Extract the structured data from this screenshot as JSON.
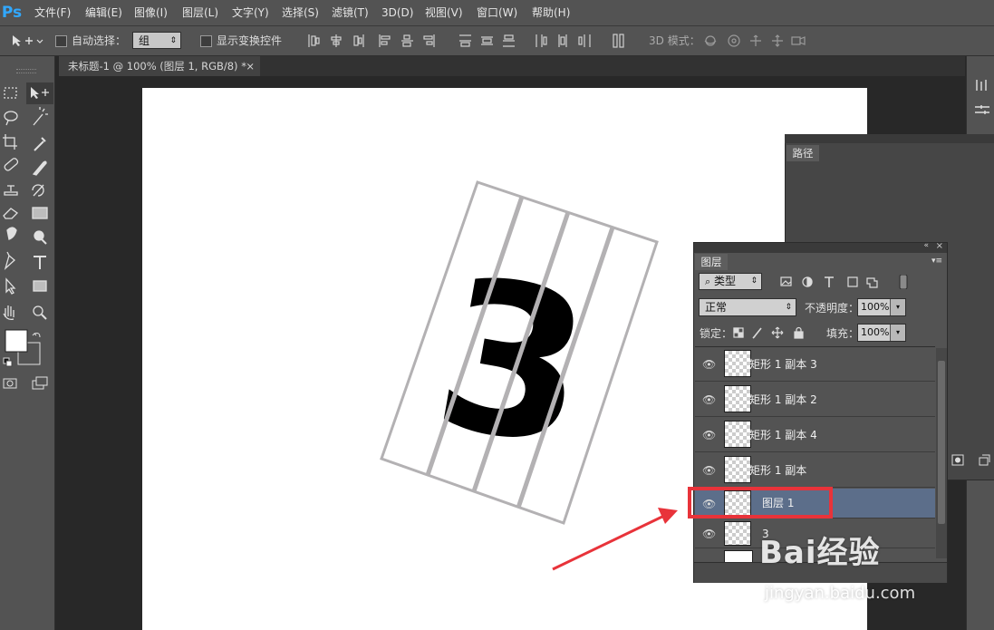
{
  "app": {
    "logo": "Ps"
  },
  "menu": [
    "文件(F)",
    "编辑(E)",
    "图像(I)",
    "图层(L)",
    "文字(Y)",
    "选择(S)",
    "滤镜(T)",
    "3D(D)",
    "视图(V)",
    "窗口(W)",
    "帮助(H)"
  ],
  "options": {
    "auto_select_label": "自动选择：",
    "auto_select_value": "组",
    "show_transform_label": "显示变换控件",
    "mode_3d_label": "3D 模式："
  },
  "document": {
    "tab_title": "未标题-1 @ 100% (图层 1, RGB/8) *",
    "close": "×"
  },
  "paths_panel": {
    "tab": "路径"
  },
  "layers_panel": {
    "tab": "图层",
    "filter_kind": "类型",
    "blend_mode": "正常",
    "opacity_label": "不透明度：",
    "opacity_value": "100%",
    "lock_label": "锁定：",
    "fill_label": "填充：",
    "fill_value": "100%",
    "layers": [
      {
        "name": "矩形 1 副本 3",
        "selected": false
      },
      {
        "name": "矩形 1 副本 2",
        "selected": false
      },
      {
        "name": "矩形 1 副本 4",
        "selected": false
      },
      {
        "name": "矩形 1 副本",
        "selected": false
      },
      {
        "name": "图层 1",
        "selected": true
      },
      {
        "name": "3",
        "selected": false
      }
    ]
  },
  "canvas": {
    "digit": "3"
  },
  "watermark": {
    "brand": "Bai经验",
    "url": "jingyan.baidu.com"
  },
  "colors": {
    "highlight": "#e8333a",
    "selected_row": "#5c6e8a",
    "ps_blue": "#31a8ff"
  }
}
